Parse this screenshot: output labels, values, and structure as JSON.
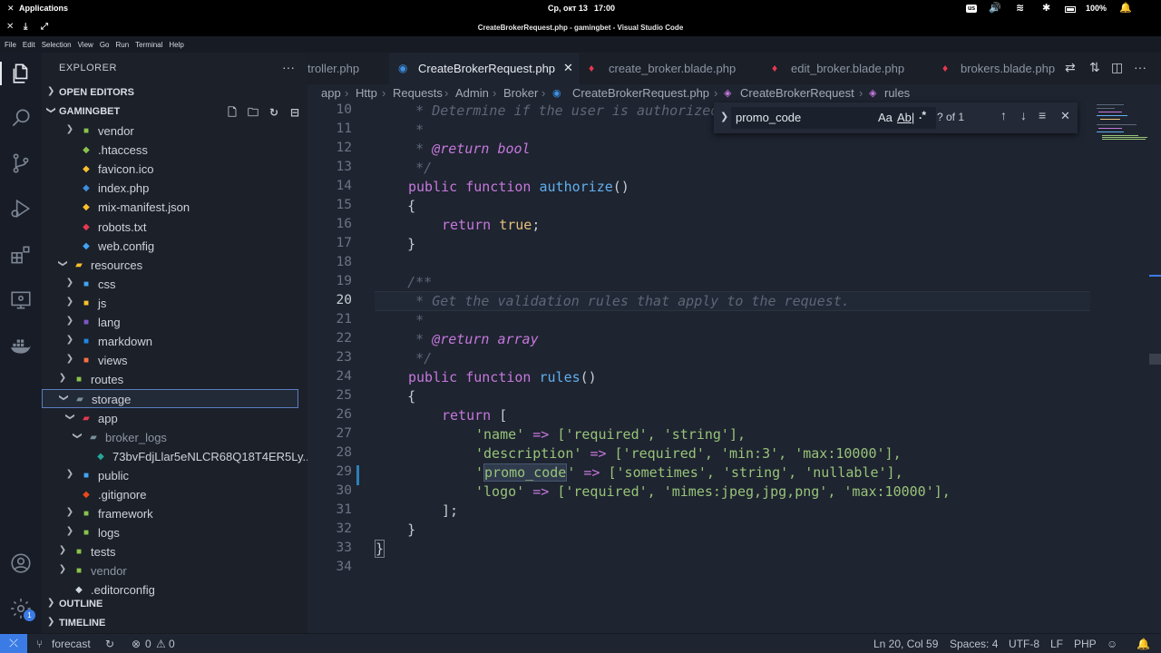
{
  "system_bar": {
    "apps_label": "Applications",
    "datetime": "Ср, окт 13",
    "time": "17:00",
    "keyboard": "us",
    "battery": "100%"
  },
  "title_bar": {
    "title": "CreateBrokerRequest.php - gamingbet - Visual Studio Code"
  },
  "menu": [
    "File",
    "Edit",
    "Selection",
    "View",
    "Go",
    "Run",
    "Terminal",
    "Help"
  ],
  "activity": {
    "icons": [
      "files-icon",
      "search-icon",
      "source-control-icon",
      "run-debug-icon",
      "extensions-icon",
      "remote-explorer-icon",
      "docker-icon",
      "account-icon",
      "settings-gear-icon"
    ],
    "settings_badge": "1"
  },
  "sidebar": {
    "title": "EXPLORER",
    "open_editors": "OPEN EDITORS",
    "workspace": "GAMINGBET",
    "outline": "OUTLINE",
    "timeline": "TIMELINE",
    "tree": [
      {
        "name": "vendor",
        "type": "folder",
        "icon_color": "#8bc34a"
      },
      {
        "name": ".htaccess",
        "type": "file",
        "icon_color": "#8bc34a"
      },
      {
        "name": "favicon.ico",
        "type": "file",
        "icon_color": "#fbc02d"
      },
      {
        "name": "index.php",
        "type": "file",
        "icon_color": "#3d8fe0"
      },
      {
        "name": "mix-manifest.json",
        "type": "file",
        "icon_color": "#fbc02d"
      },
      {
        "name": "robots.txt",
        "type": "file",
        "icon_color": "#e53950"
      },
      {
        "name": "web.config",
        "type": "file",
        "icon_color": "#42a5f5"
      },
      {
        "name": "resources",
        "type": "folder-open",
        "icon_color": "#fbc02d"
      },
      {
        "name": "css",
        "type": "folder",
        "icon_color": "#42a5f5"
      },
      {
        "name": "js",
        "type": "folder",
        "icon_color": "#fbc02d"
      },
      {
        "name": "lang",
        "type": "folder",
        "icon_color": "#7e57c2"
      },
      {
        "name": "markdown",
        "type": "folder",
        "icon_color": "#1e88e5"
      },
      {
        "name": "views",
        "type": "folder",
        "icon_color": "#ff7043"
      },
      {
        "name": "routes",
        "type": "folder",
        "icon_color": "#8bc34a"
      },
      {
        "name": "storage",
        "type": "folder-open",
        "icon_color": "#78909c"
      },
      {
        "name": "app",
        "type": "folder-open",
        "icon_color": "#e53950"
      },
      {
        "name": "broker_logs",
        "type": "folder-open",
        "icon_color": "#78909c"
      },
      {
        "name": "73bvFdjLlar5eNLCR68Q18T4ER5Ly...",
        "type": "file",
        "icon_color": "#26a69a"
      },
      {
        "name": "public",
        "type": "folder",
        "icon_color": "#42a5f5"
      },
      {
        "name": ".gitignore",
        "type": "file",
        "icon_color": "#e64a19"
      },
      {
        "name": "framework",
        "type": "folder",
        "icon_color": "#8bc34a"
      },
      {
        "name": "logs",
        "type": "folder",
        "icon_color": "#8bc34a"
      },
      {
        "name": "tests",
        "type": "folder",
        "icon_color": "#8bc34a"
      },
      {
        "name": "vendor",
        "type": "folder",
        "icon_color": "#8bc34a"
      },
      {
        "name": ".editorconfig",
        "type": "file",
        "icon_color": "#cfd8dc"
      }
    ]
  },
  "tabs": [
    {
      "label": "troller.php",
      "icon": "php-icon",
      "icon_color": "#3d8fe0"
    },
    {
      "label": "CreateBrokerRequest.php",
      "icon": "php-icon",
      "icon_color": "#3d8fe0",
      "active": true
    },
    {
      "label": "create_broker.blade.php",
      "icon": "laravel-icon",
      "icon_color": "#e53950"
    },
    {
      "label": "edit_broker.blade.php",
      "icon": "laravel-icon",
      "icon_color": "#e53950"
    },
    {
      "label": "brokers.blade.php",
      "icon": "laravel-icon",
      "icon_color": "#e53950"
    }
  ],
  "breadcrumb": [
    "app",
    "Http",
    "Requests",
    "Admin",
    "Broker",
    "CreateBrokerRequest.php",
    "CreateBrokerRequest",
    "rules"
  ],
  "find": {
    "query": "promo_code",
    "match_case": "Aa",
    "whole_word": "Ab|",
    "regex": ".*",
    "count": "? of 1"
  },
  "editor": {
    "current_line": 20,
    "line_numbers": [
      "10",
      "11",
      "12",
      "13",
      "14",
      "15",
      "16",
      "17",
      "18",
      "19",
      "20",
      "21",
      "22",
      "23",
      "24",
      "25",
      "26",
      "27",
      "28",
      "29",
      "30",
      "31",
      "32",
      "33",
      "34"
    ],
    "lines": {
      "l10": "     * Determine if the user is authorized",
      "l11": "     *",
      "l12_star": "     * ",
      "l12_doc": "@return bool",
      "l13": "     */",
      "l14_kw": "public function",
      "l14_fn": "authorize",
      "l14_rest": "()",
      "l15": "    {",
      "l16_kw": "return",
      "l16_val": "true",
      "l16_end": ";",
      "l17": "    }",
      "l19": "    /**",
      "l20": "     * Get the validation rules that apply to the request.",
      "l21": "     *",
      "l22_star": "     * ",
      "l22_doc": "@return array",
      "l23": "     */",
      "l24_kw": "public function",
      "l24_fn": "rules",
      "l24_rest": "()",
      "l25": "    {",
      "l26_kw": "return",
      "l26_rest": " [",
      "l27_key": "'name'",
      "l27_vals": "['required', 'string'],",
      "l28_key": "'description'",
      "l28_vals": "['required', 'min:3', 'max:10000'],",
      "l29_q1": "'",
      "l29_key": "promo_code",
      "l29_q2": "'",
      "l29_vals": "['sometimes', 'string', 'nullable'],",
      "l30_key": "'logo'",
      "l30_vals": "['required', 'mimes:jpeg,jpg,png', 'max:10000'],",
      "l31": "];",
      "l32": "    }",
      "l33": "}",
      "arrow": "=>"
    }
  },
  "status": {
    "branch": "forecast",
    "errors": "0",
    "warnings": "0",
    "position": "Ln 20, Col 59",
    "spaces": "Spaces: 4",
    "encoding": "UTF-8",
    "eol": "LF",
    "language": "PHP"
  }
}
